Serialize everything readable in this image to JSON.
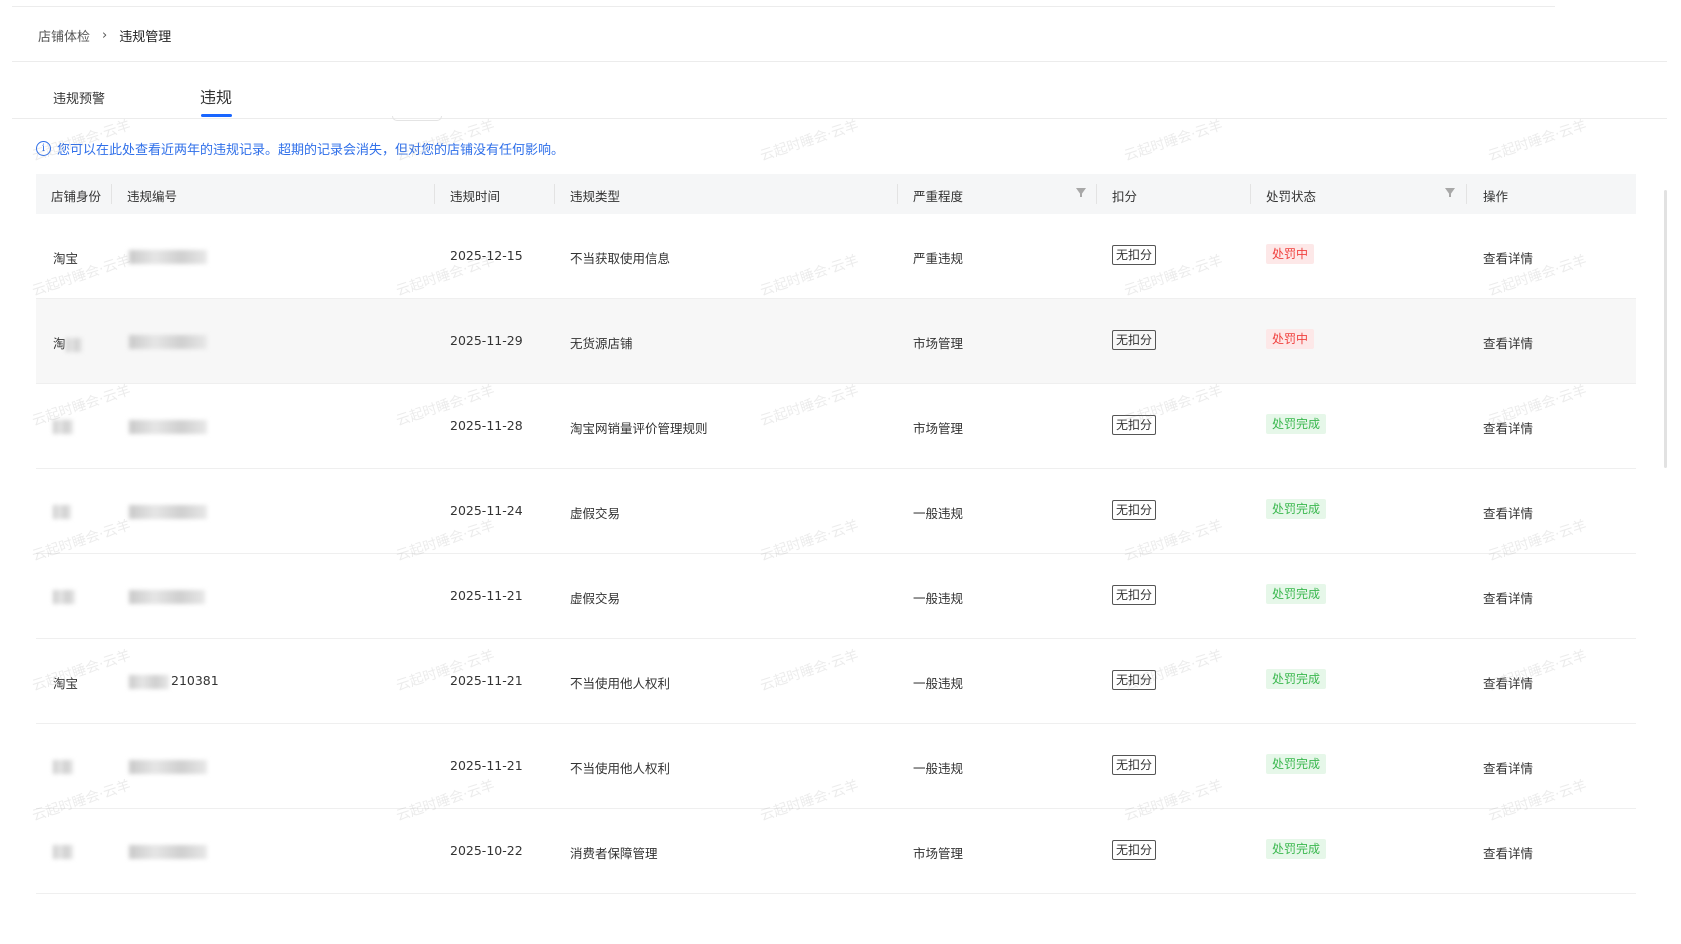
{
  "breadcrumb": {
    "parent": "店铺体检",
    "separator": "›",
    "current": "违规管理"
  },
  "tabs": [
    {
      "label": "违规预警"
    },
    {
      "label": "违规",
      "active": true
    }
  ],
  "notice": {
    "icon": "info-icon",
    "text": "您可以在此处查看近两年的违规记录。超期的记录会消失，但对您的店铺没有任何影响。"
  },
  "table": {
    "headers": {
      "shop": "店铺身份",
      "id": "违规编号",
      "date": "违规时间",
      "type": "违规类型",
      "severity": "严重程度",
      "points": "扣分",
      "status": "处罚状态",
      "op": "操作"
    },
    "rows": [
      {
        "shop": "淘宝",
        "id": "",
        "date": "2025-12-15",
        "type": "不当获取使用信息",
        "severity": "严重违规",
        "points": "无扣分",
        "status": "处罚中",
        "status_color": "red",
        "op": "查看详情"
      },
      {
        "shop": "淘",
        "id": "",
        "date": "2025-11-29",
        "type": "无货源店铺",
        "severity": "市场管理",
        "points": "无扣分",
        "status": "处罚中",
        "status_color": "red",
        "op": "查看详情"
      },
      {
        "shop": "",
        "id": "",
        "date": "2025-11-28",
        "type": "淘宝网销量评价管理规则",
        "severity": "市场管理",
        "points": "无扣分",
        "status": "处罚完成",
        "status_color": "green",
        "op": "查看详情"
      },
      {
        "shop": "",
        "id": "",
        "date": "2025-11-24",
        "type": "虚假交易",
        "severity": "一般违规",
        "points": "无扣分",
        "status": "处罚完成",
        "status_color": "green",
        "op": "查看详情"
      },
      {
        "shop": "",
        "id": "",
        "date": "2025-11-21",
        "type": "虚假交易",
        "severity": "一般违规",
        "points": "无扣分",
        "status": "处罚完成",
        "status_color": "green",
        "op": "查看详情"
      },
      {
        "shop": "淘宝",
        "id": "210381",
        "date": "2025-11-21",
        "type": "不当使用他人权利",
        "severity": "一般违规",
        "points": "无扣分",
        "status": "处罚完成",
        "status_color": "green",
        "op": "查看详情"
      },
      {
        "shop": "",
        "id": "",
        "date": "2025-11-21",
        "type": "不当使用他人权利",
        "severity": "一般违规",
        "points": "无扣分",
        "status": "处罚完成",
        "status_color": "green",
        "op": "查看详情"
      },
      {
        "shop": "",
        "id": "",
        "date": "2025-10-22",
        "type": "消费者保障管理",
        "severity": "市场管理",
        "points": "无扣分",
        "status": "处罚完成",
        "status_color": "green",
        "op": "查看详情"
      }
    ]
  },
  "watermark": "云起时睡会·云羊",
  "colors": {
    "accent": "#1966ff",
    "link": "#2a6ff0",
    "danger": "#f0413e",
    "success": "#3bb84f"
  }
}
